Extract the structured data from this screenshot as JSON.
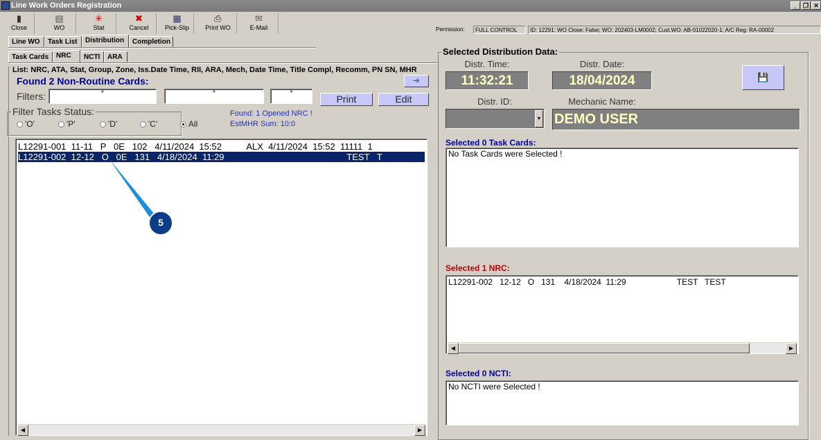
{
  "window": {
    "title": "Line Work Orders Registration"
  },
  "toolbar": [
    {
      "label": "Close",
      "icon": "door-exit-icon"
    },
    {
      "label": "WO",
      "icon": "folder-icon"
    },
    {
      "label": "Stat",
      "icon": "stat-icon"
    },
    {
      "label": "Cancel",
      "icon": "cancel-x-icon"
    },
    {
      "label": "Pick-Slip",
      "icon": "pick-slip-icon"
    },
    {
      "label": "Print WO",
      "icon": "printer-icon"
    },
    {
      "label": "E-Mail",
      "icon": "envelope-icon"
    }
  ],
  "status": {
    "permission_label": "Permission:",
    "permission_value": "FULL CONTROL",
    "info": "ID: 12291; WO Close: False; WO: 202403-LM0002; Cust.WO: AB-01022020-1; A/C Reg: RA-00002"
  },
  "tabs": [
    "Line WO",
    "Task List",
    "Distribution",
    "Completion"
  ],
  "subtabs": [
    "Task Cards",
    "NRC",
    "NCTI",
    "ARA"
  ],
  "left": {
    "list_header": "List: NRC, ATA, Stat, Group, Zone, Iss.Date Time, RII, ARA, Mech, Date Time, Title Compl, Recomm, PN SN, MHR",
    "found_title": "Found 2 Non-Routine Cards:",
    "filters_label": "Filters:",
    "filter_values": [
      "*",
      "*",
      "*"
    ],
    "print_label": "Print",
    "edit_label": "Edit",
    "status_legend": "Filter Tasks Status:",
    "radios": [
      {
        "label": "'O'",
        "checked": false
      },
      {
        "label": "'P'",
        "checked": false
      },
      {
        "label": "'D'",
        "checked": false
      },
      {
        "label": "'C'",
        "checked": false
      },
      {
        "label": "All",
        "checked": true
      }
    ],
    "found_opened": "Found: 1 Opened NRC !",
    "est_mhr": "EstMHR Sum: 10:0",
    "rows": [
      "L12291-001  11-11   P   0E   102   4/11/2024  15:52          ALX  4/11/2024  15:52  11111  1",
      "L12291-002  12-12   O   0E   131   4/18/2024  11:29                                                 TEST   T"
    ],
    "callout": "5"
  },
  "right": {
    "legend": "Selected Distribution Data:",
    "time_label": "Distr. Time:",
    "time_value": "11:32:21",
    "date_label": "Distr. Date:",
    "date_value": "18/04/2024",
    "id_label": "Distr. ID:",
    "id_value": "",
    "mech_label": "Mechanic Name:",
    "mech_value": "DEMO USER",
    "task_cards_title": "Selected 0 Task Cards:",
    "task_cards_text": "No Task Cards were Selected !",
    "nrc_title": "Selected 1 NRC:",
    "nrc_row": "L12291-002   12-12   O   131    4/18/2024  11:29                      TEST   TEST",
    "ncti_title": "Selected 0 NCTI:",
    "ncti_text": "No NCTI were Selected !"
  },
  "colors": {
    "section_blue": "#0000a0",
    "section_red": "#c00000",
    "selection": "#0a246a",
    "button": "#c8c8f8"
  }
}
